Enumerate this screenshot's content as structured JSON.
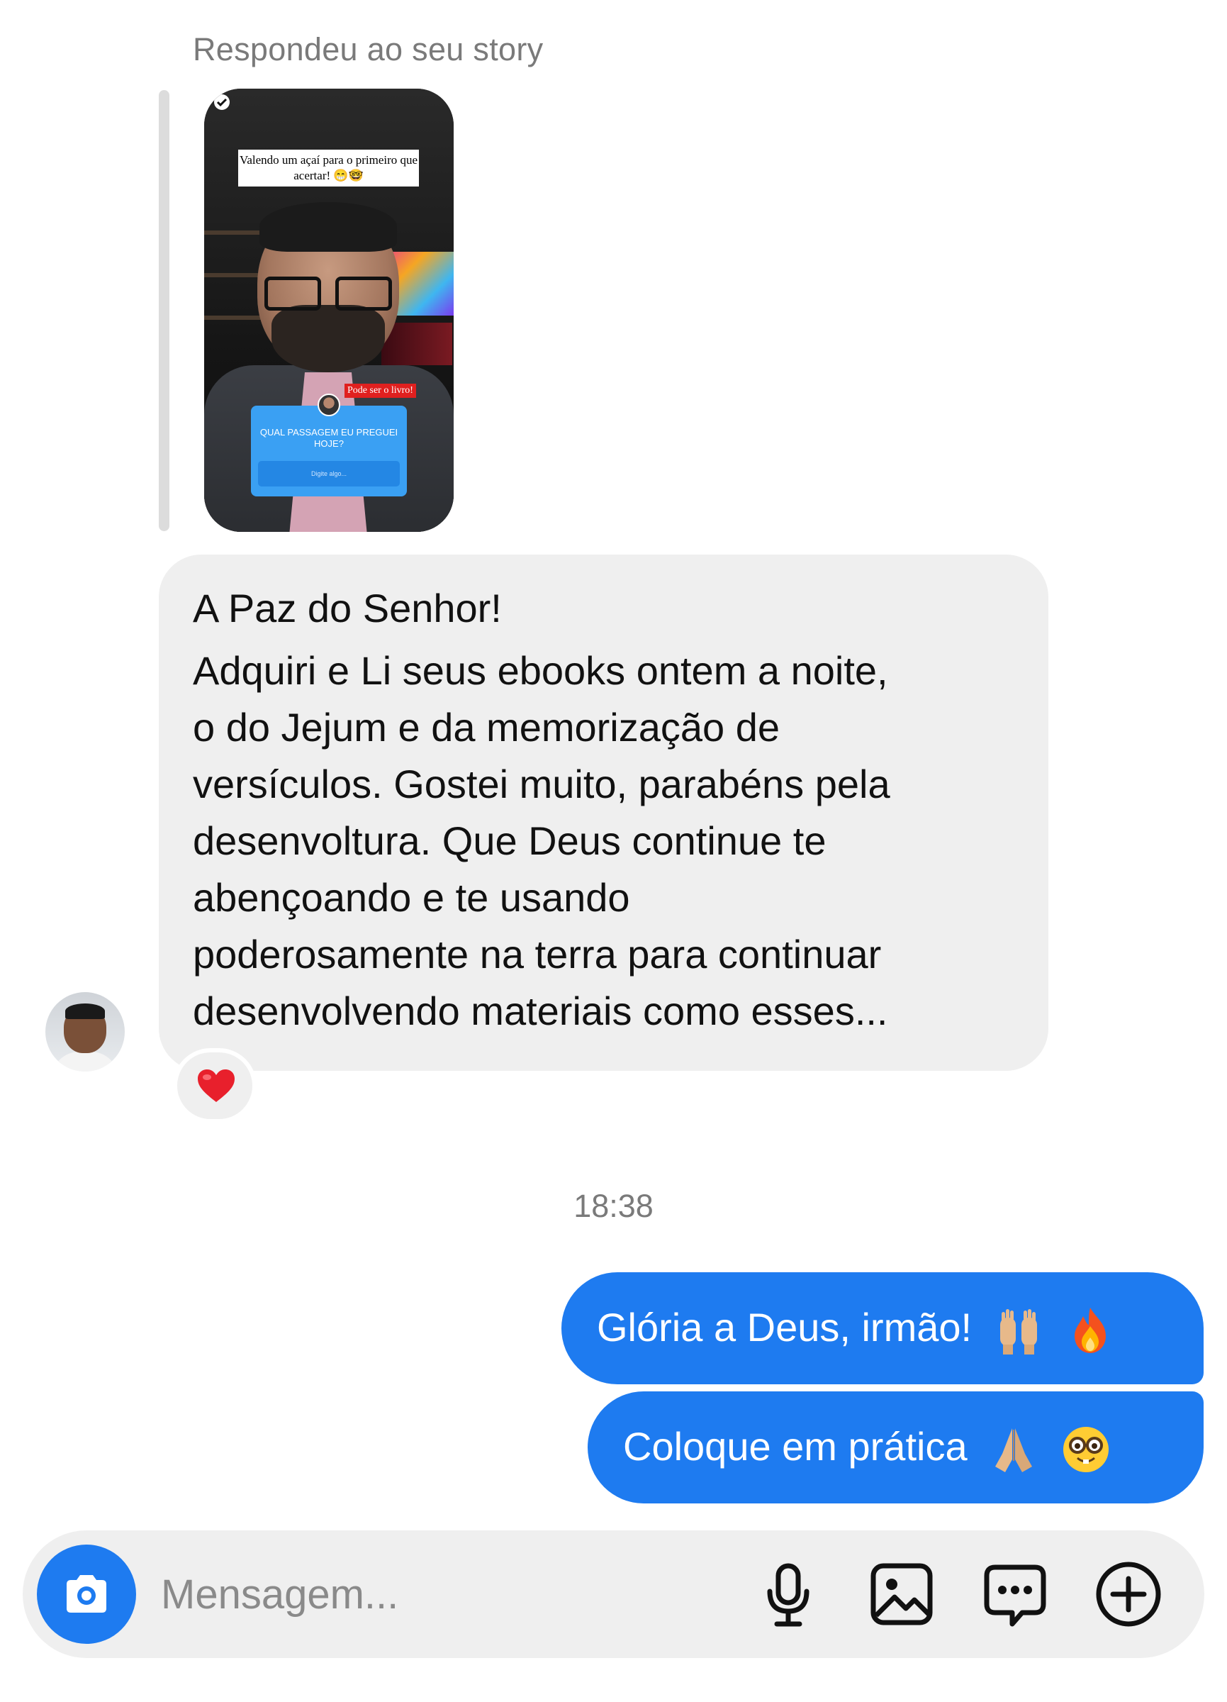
{
  "story": {
    "caption": "Respondeu ao seu story",
    "overlay_caption": "Valendo um açaí para o primeiro que acertar! 😁🤓",
    "tag": "Pode ser o livro!",
    "question": "QUAL PASSAGEM EU PREGUEI HOJE?",
    "question_placeholder": "Digite algo..."
  },
  "incoming": {
    "greeting": "A Paz do Senhor!",
    "lines": [
      "Adquiri e Li seus ebooks ontem a noite,",
      "o do Jejum e da memorização de",
      "versículos. Gostei muito, parabéns pela",
      "desenvoltura. Que Deus continue te",
      "abençoando e te usando",
      "poderosamente na terra para continuar",
      "desenvolvendo materiais como esses..."
    ],
    "reaction": "❤️"
  },
  "timestamp": "18:38",
  "outgoing": [
    {
      "text": "Glória a Deus, irmão!",
      "emojis": [
        "raising-hands-icon",
        "fire-icon"
      ]
    },
    {
      "text": "Coloque em prática",
      "emojis": [
        "folded-hands-icon",
        "nerd-face-icon"
      ]
    }
  ],
  "composer": {
    "placeholder": "Mensagem..."
  },
  "colors": {
    "accent": "#1e7bf0",
    "incoming_bubble": "#efefef",
    "muted_text": "#7a7a7a"
  }
}
